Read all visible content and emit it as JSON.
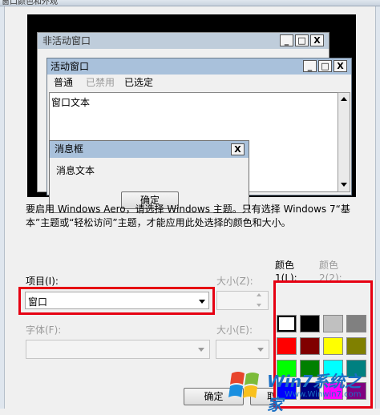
{
  "dialog": {
    "title": "窗口颜色和外观"
  },
  "preview": {
    "inactive_title": "非活动窗口",
    "active_title": "活动窗口",
    "menus": [
      "普通",
      "已禁用",
      "已选定"
    ],
    "window_text": "窗口文本",
    "msgbox_title": "消息框",
    "msgbox_text": "消息文本",
    "msgbox_ok": "确定",
    "ctl_min": "_",
    "ctl_max": "□",
    "ctl_close": "X"
  },
  "description": "要启用 Windows Aero，请选择 Windows 主题。只有选择 Windows 7“基本”主题或“轻松访问”主题，才能应用此处选择的颜色和大小。",
  "form": {
    "item_label": "项目(I):",
    "item_value": "窗口",
    "size_label": "大小(Z):",
    "color1_label": "颜色 1(L):",
    "color2_label": "颜色 2(2):",
    "font_label": "字体(F):",
    "fontsize_label": "大小(E):"
  },
  "color1_selected": "#ffffff",
  "palette": [
    "#ffffff",
    "#000000",
    "#c0c0c0",
    "#808080",
    "#ff0000",
    "#800000",
    "#ffff00",
    "#808000",
    "#00ff00",
    "#008000",
    "#00ffff",
    "#008080",
    "#0000ff",
    "#000080",
    "#ff00ff",
    "#800080"
  ],
  "footer": {
    "ok": "确定",
    "cancel": "取"
  },
  "watermark": {
    "brand": "Win7系统之家",
    "url": "Www.Winwin7.com"
  }
}
